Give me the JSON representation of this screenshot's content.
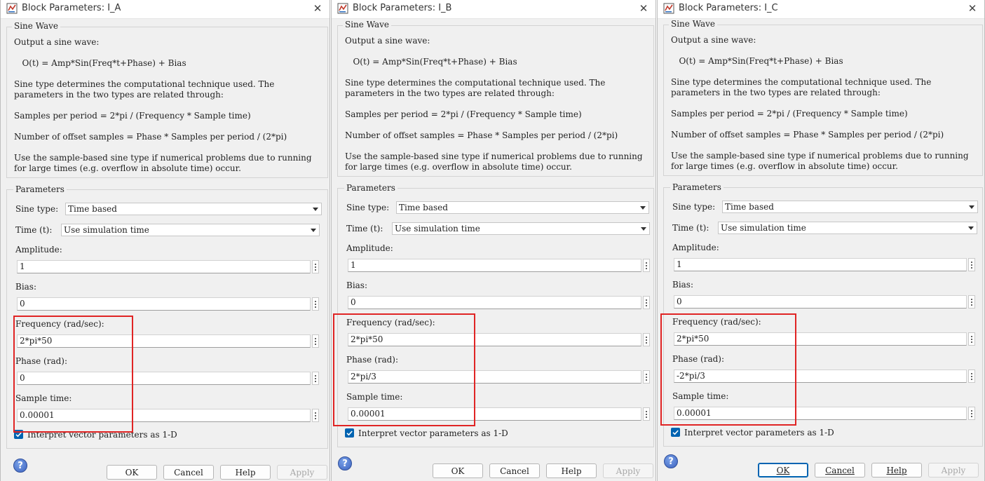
{
  "dialogs": [
    {
      "title": "Block Parameters: I_A",
      "sine_wave_group": "Sine Wave",
      "description": [
        "Output a sine wave:",
        "   O(t) = Amp*Sin(Freq*t+Phase) + Bias",
        "Sine type determines the computational technique used. The",
        "parameters in the two types are related through:",
        "Samples per period = 2*pi / (Frequency * Sample time)",
        "Number of offset samples = Phase * Samples per period / (2*pi)",
        "Use the sample-based sine type if numerical problems due to running",
        "for large times (e.g. overflow in absolute time) occur."
      ],
      "parameters_group": "Parameters",
      "sine_type_label": "Sine type:",
      "sine_type_value": "Time based",
      "time_label": "Time (t):",
      "time_value": "Use simulation time",
      "amplitude_label": "Amplitude:",
      "amplitude_value": "1",
      "bias_label": "Bias:",
      "bias_value": "0",
      "frequency_label": "Frequency (rad/sec):",
      "frequency_value": "2*pi*50",
      "phase_label": "Phase (rad):",
      "phase_value": "0",
      "sample_time_label": "Sample time:",
      "sample_time_value": "0.00001",
      "checkbox_label": "Interpret vector parameters as 1-D",
      "checkbox_checked": true,
      "buttons": {
        "ok": "OK",
        "cancel": "Cancel",
        "help": "Help",
        "apply": "Apply"
      }
    },
    {
      "title": "Block Parameters: I_B",
      "sine_wave_group": "Sine Wave",
      "description": [
        "Output a sine wave:",
        "   O(t) = Amp*Sin(Freq*t+Phase) + Bias",
        "Sine type determines the computational technique used. The",
        "parameters in the two types are related through:",
        "Samples per period = 2*pi / (Frequency * Sample time)",
        "Number of offset samples = Phase * Samples per period / (2*pi)",
        "Use the sample-based sine type if numerical problems due to running",
        "for large times (e.g. overflow in absolute time) occur."
      ],
      "parameters_group": "Parameters",
      "sine_type_label": "Sine type:",
      "sine_type_value": "Time based",
      "time_label": "Time (t):",
      "time_value": "Use simulation time",
      "amplitude_label": "Amplitude:",
      "amplitude_value": "1",
      "bias_label": "Bias:",
      "bias_value": "0",
      "frequency_label": "Frequency (rad/sec):",
      "frequency_value": "2*pi*50",
      "phase_label": "Phase (rad):",
      "phase_value": "2*pi/3",
      "sample_time_label": "Sample time:",
      "sample_time_value": "0.00001",
      "checkbox_label": "Interpret vector parameters as 1-D",
      "checkbox_checked": true,
      "buttons": {
        "ok": "OK",
        "cancel": "Cancel",
        "help": "Help",
        "apply": "Apply"
      }
    },
    {
      "title": "Block Parameters: I_C",
      "sine_wave_group": "Sine Wave",
      "description": [
        "Output a sine wave:",
        "   O(t) = Amp*Sin(Freq*t+Phase) + Bias",
        "Sine type determines the computational technique used. The",
        "parameters in the two types are related through:",
        "Samples per period = 2*pi / (Frequency * Sample time)",
        "Number of offset samples = Phase * Samples per period / (2*pi)",
        "Use the sample-based sine type if numerical problems due to running",
        "for large times (e.g. overflow in absolute time) occur."
      ],
      "parameters_group": "Parameters",
      "sine_type_label": "Sine type:",
      "sine_type_value": "Time based",
      "time_label": "Time (t):",
      "time_value": "Use simulation time",
      "amplitude_label": "Amplitude:",
      "amplitude_value": "1",
      "bias_label": "Bias:",
      "bias_value": "0",
      "frequency_label": "Frequency (rad/sec):",
      "frequency_value": "2*pi*50",
      "phase_label": "Phase (rad):",
      "phase_value": "-2*pi/3",
      "sample_time_label": "Sample time:",
      "sample_time_value": "0.00001",
      "checkbox_label": "Interpret vector parameters as 1-D",
      "checkbox_checked": true,
      "buttons": {
        "ok": "OK",
        "cancel": "Cancel",
        "help": "Help",
        "apply": "Apply"
      }
    }
  ],
  "icons": {
    "app": "simulink-block-icon",
    "close": "close-icon",
    "help": "help-icon",
    "dropdown": "chevron-down-icon",
    "more": "vertical-ellipsis-icon",
    "check": "checkmark-icon"
  },
  "colors": {
    "dialog_bg": "#f0f0f0",
    "highlight": "#e02424",
    "checkbox": "#0063b1",
    "default_button_border": "#0063b1"
  }
}
